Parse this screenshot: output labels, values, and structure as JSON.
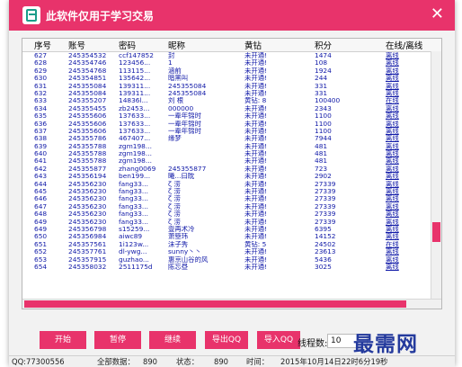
{
  "app": {
    "title": "此软件仅用于学习交易"
  },
  "table": {
    "columns": [
      "序号",
      "账号",
      "密码",
      "昵称",
      "黄钻",
      "积分",
      "在线/离线"
    ],
    "rows": [
      [
        "627",
        "245354532",
        "ccf147852",
        "封",
        "未开通!",
        "1474",
        "离线"
      ],
      [
        "628",
        "245354746",
        "123456...",
        "1",
        "未开通!",
        "108",
        "离线"
      ],
      [
        "629",
        "245354768",
        "113115...",
        "涵前",
        "未开通!",
        "1924",
        "离线"
      ],
      [
        "630",
        "245354851",
        "135642...",
        "暗黑叫",
        "未开通!",
        "244",
        "离线"
      ],
      [
        "631",
        "245355084",
        "139311...",
        "245355084",
        "未开通!",
        "331",
        "离线"
      ],
      [
        "632",
        "245355084",
        "139311...",
        "245355084",
        "未开通!",
        "331",
        "离线"
      ],
      [
        "633",
        "245355207",
        "14836l...",
        "刘 根",
        "黄钻: 8",
        "100400",
        "在线"
      ],
      [
        "634",
        "245355455",
        "zb2453...",
        "000000",
        "未开通!",
        "2343",
        "离线"
      ],
      [
        "635",
        "245355606",
        "137633...",
        "一辈年锦时",
        "未开通!",
        "1100",
        "离线"
      ],
      [
        "636",
        "245355606",
        "137633...",
        "一辈年锦时",
        "未开通!",
        "1100",
        "离线"
      ],
      [
        "637",
        "245355606",
        "137633...",
        "一辈年锦时",
        "未开通!",
        "1100",
        "离线"
      ],
      [
        "638",
        "245355786",
        "467407...",
        "缘梦",
        "未开通!",
        "7944",
        "离线"
      ],
      [
        "639",
        "245355788",
        "zgm198...",
        "",
        "未开通!",
        "481",
        "离线"
      ],
      [
        "640",
        "245355788",
        "zgm198...",
        "",
        "未开通!",
        "481",
        "离线"
      ],
      [
        "641",
        "245355788",
        "zgm198...",
        "",
        "未开通!",
        "481",
        "离线"
      ],
      [
        "642",
        "245355877",
        "zhang0069",
        "245355877",
        "未开通!",
        "723",
        "离线"
      ],
      [
        "643",
        "245356194",
        "ben199...",
        "曦...曰眈",
        "未开通!",
        "2902",
        "离线"
      ],
      [
        "644",
        "245356230",
        "fang33...",
        "ζ 涝",
        "未开通!",
        "27339",
        "离线"
      ],
      [
        "645",
        "245356230",
        "fang33...",
        "ζ 涝",
        "未开通!",
        "27339",
        "离线"
      ],
      [
        "646",
        "245356230",
        "fang33...",
        "ζ 涝",
        "未开通!",
        "27339",
        "离线"
      ],
      [
        "647",
        "245356230",
        "fang33...",
        "ζ 涝",
        "未开通!",
        "27339",
        "离线"
      ],
      [
        "648",
        "245356230",
        "fang33...",
        "ζ 涝",
        "未开通!",
        "27339",
        "离线"
      ],
      [
        "649",
        "245356230",
        "fang33...",
        "ζ 涝",
        "未开通!",
        "27339",
        "离线"
      ],
      [
        "649",
        "245356798",
        "s15259...",
        "壹再术冷",
        "未开通!",
        "6395",
        "离线"
      ],
      [
        "650",
        "245356984",
        "aiwc89",
        "萧箜玮",
        "未开通!",
        "14152",
        "离线"
      ],
      [
        "651",
        "245357561",
        "1i123w...",
        "沫子秀",
        "黄钻: 5",
        "24502",
        "在线"
      ],
      [
        "652",
        "245357761",
        "dl-ywg...",
        "sunny丶丶",
        "未开通!",
        "23613",
        "离线"
      ],
      [
        "653",
        "245357915",
        "guzhao...",
        "惠京山谷的风",
        "未开通!",
        "5436",
        "离线"
      ],
      [
        "654",
        "245358032",
        "2511175d",
        "陈忘昼",
        "未开通!",
        "3025",
        "离线"
      ]
    ]
  },
  "scrollbars": {
    "vertical_position": 0.72,
    "horizontal_thumb_fraction": 0.91
  },
  "controls": {
    "start": "开始",
    "pause": "暂停",
    "continue": "继续",
    "export_qq": "导出QQ",
    "import_qq": "导入QQ",
    "thread_label": "线程数:",
    "thread_value": "10"
  },
  "status": {
    "qq": "QQ:77300556",
    "total": "全部数据：",
    "total_value": "890",
    "state": "状态：",
    "state_value": "890",
    "time": "时间：",
    "time_value": "2015年10月14日22时6分19秒"
  },
  "watermark": "最需网",
  "colors": {
    "accent": "#e8336b",
    "row_text": "#111aa8",
    "watermark": "#243a9d"
  }
}
